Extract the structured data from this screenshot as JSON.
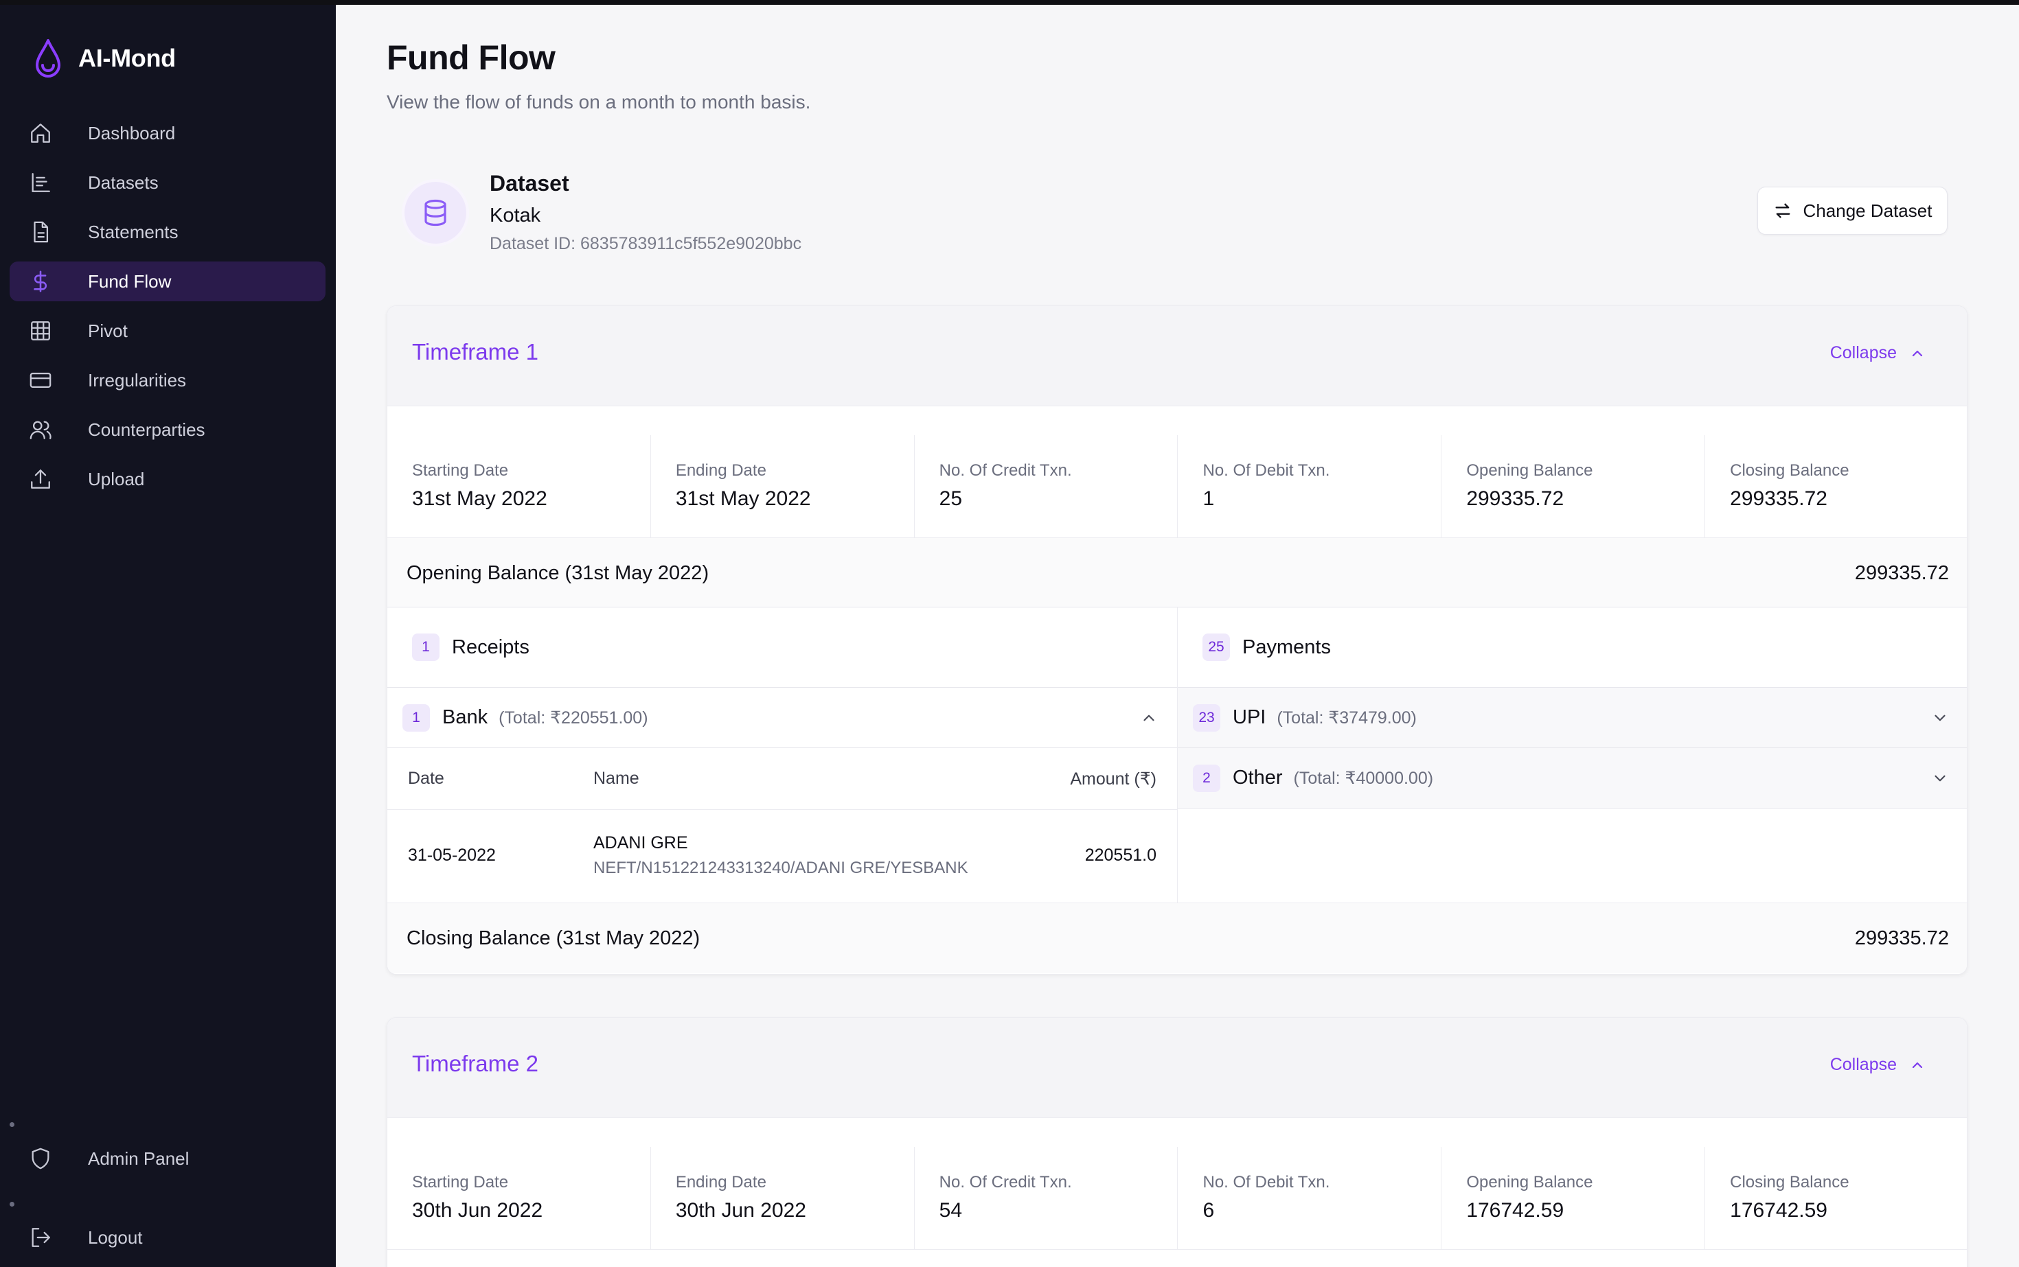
{
  "brand": {
    "name": "AI-Mond"
  },
  "sidebar": {
    "items": [
      {
        "label": "Dashboard",
        "icon": "home-icon"
      },
      {
        "label": "Datasets",
        "icon": "datasets-icon"
      },
      {
        "label": "Statements",
        "icon": "document-icon"
      },
      {
        "label": "Fund Flow",
        "icon": "dollar-icon",
        "active": true
      },
      {
        "label": "Pivot",
        "icon": "table-icon"
      },
      {
        "label": "Irregularities",
        "icon": "card-icon"
      },
      {
        "label": "Counterparties",
        "icon": "users-icon"
      },
      {
        "label": "Upload",
        "icon": "upload-icon"
      }
    ],
    "admin": "Admin Panel",
    "logout": "Logout"
  },
  "page": {
    "title": "Fund Flow",
    "subtitle": "View the flow of funds on a month to month basis."
  },
  "dataset": {
    "title": "Dataset",
    "name": "Kotak",
    "id_text": "Dataset ID: 6835783911c5f552e9020bbc",
    "change_label": "Change Dataset"
  },
  "timeframes": [
    {
      "title": "Timeframe 1",
      "collapse": "Collapse",
      "stats": [
        {
          "label": "Starting Date",
          "value": "31st May 2022"
        },
        {
          "label": "Ending Date",
          "value": "31st May 2022"
        },
        {
          "label": "No. Of Credit Txn.",
          "value": "25"
        },
        {
          "label": "No. Of Debit Txn.",
          "value": "1"
        },
        {
          "label": "Opening Balance",
          "value": "299335.72"
        },
        {
          "label": "Closing Balance",
          "value": "299335.72"
        }
      ],
      "opening_label": "Opening Balance (31st May 2022)",
      "opening_value": "299335.72",
      "closing_label": "Closing Balance (31st May 2022)",
      "closing_value": "299335.72",
      "receipts": {
        "count": "1",
        "title": "Receipts",
        "groups": [
          {
            "count": "1",
            "name": "Bank",
            "total": "(Total: ₹220551.00)",
            "columns": [
              "Date",
              "Name",
              "Amount (₹)"
            ],
            "rows": [
              {
                "date": "31-05-2022",
                "name": "ADANI GRE",
                "desc": "NEFT/N151221243313240/ADANI GRE/YESBANK",
                "amount": "220551.0"
              }
            ]
          }
        ]
      },
      "payments": {
        "count": "25",
        "title": "Payments",
        "groups": [
          {
            "count": "23",
            "name": "UPI",
            "total": "(Total: ₹37479.00)"
          },
          {
            "count": "2",
            "name": "Other",
            "total": "(Total: ₹40000.00)"
          }
        ]
      }
    },
    {
      "title": "Timeframe 2",
      "collapse": "Collapse",
      "stats": [
        {
          "label": "Starting Date",
          "value": "30th Jun 2022"
        },
        {
          "label": "Ending Date",
          "value": "30th Jun 2022"
        },
        {
          "label": "No. Of Credit Txn.",
          "value": "54"
        },
        {
          "label": "No. Of Debit Txn.",
          "value": "6"
        },
        {
          "label": "Opening Balance",
          "value": "176742.59"
        },
        {
          "label": "Closing Balance",
          "value": "176742.59"
        }
      ]
    }
  ],
  "colors": {
    "accent": "#7c3aed",
    "sidebar": "#121320",
    "active_bg": "#2a1b4b"
  }
}
